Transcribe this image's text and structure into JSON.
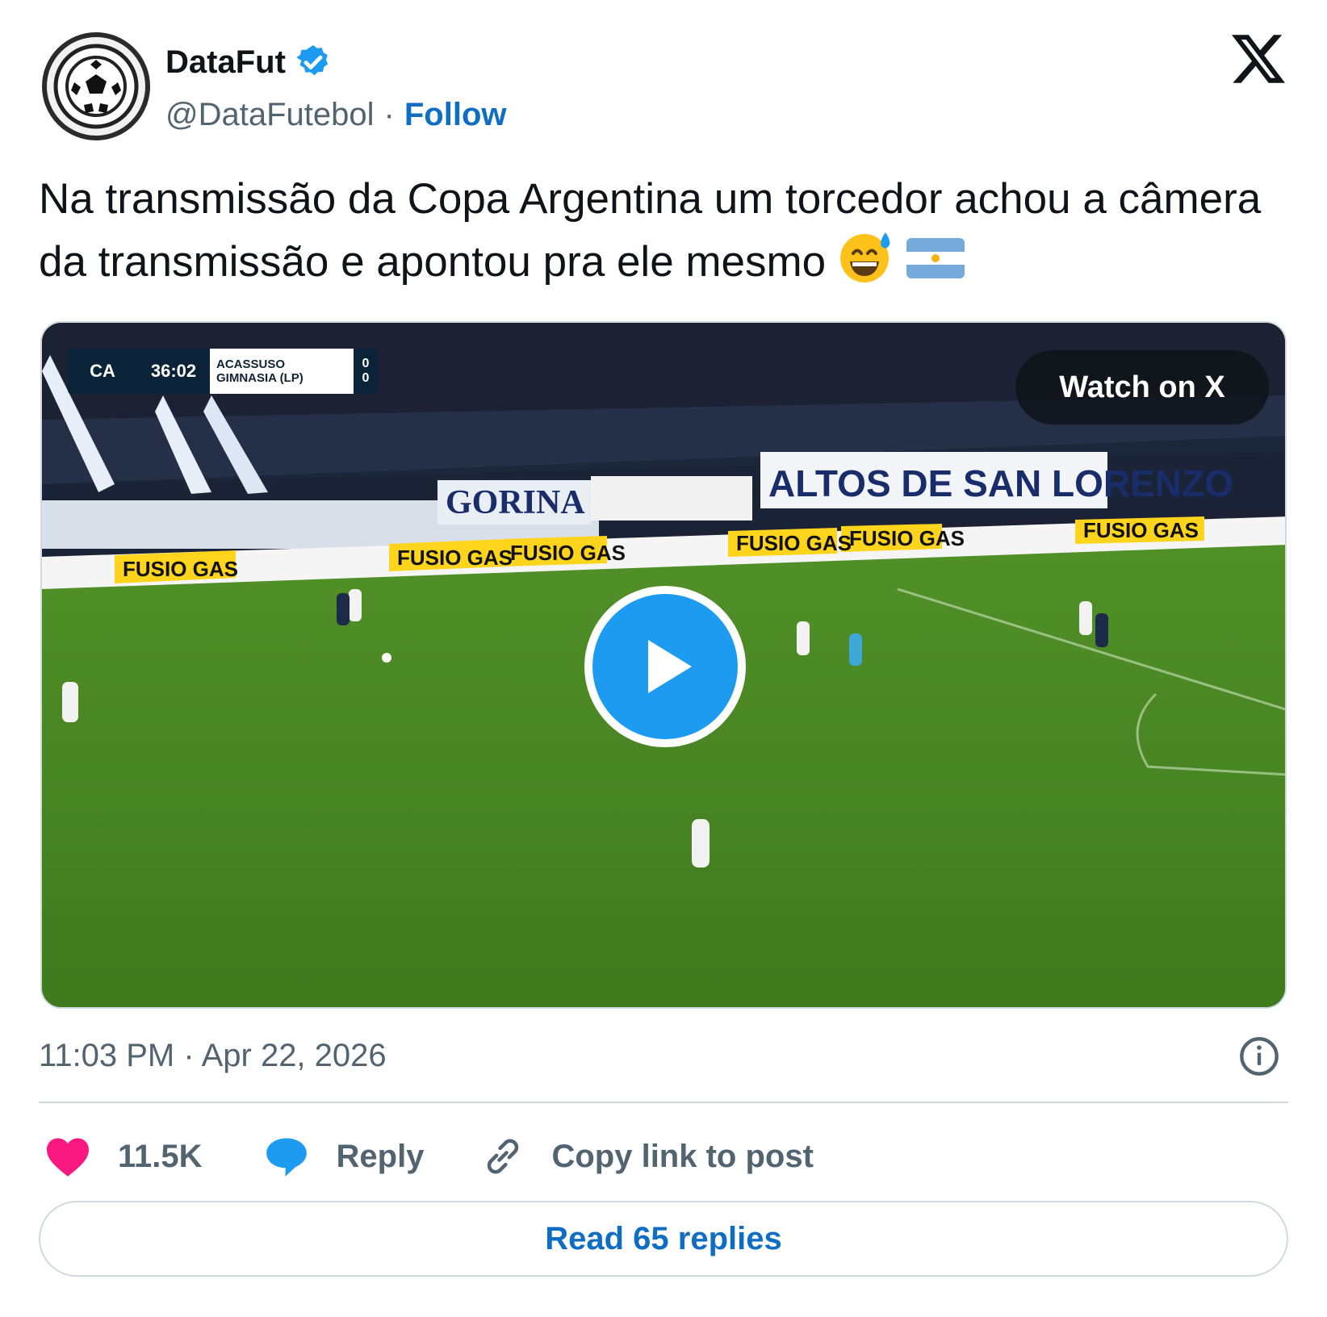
{
  "author": {
    "display_name": "DataFut",
    "handle": "@DataFutebol",
    "separator": "·",
    "follow_label": "Follow",
    "verified": true
  },
  "brand": {
    "icon": "x-logo-icon"
  },
  "tweet": {
    "text": "Na transmissão da Copa Argentina um torcedor achou a câmera da transmissão e apontou pra ele mesmo",
    "emojis": [
      "grinning-face-with-sweat",
      "argentina-flag"
    ]
  },
  "media": {
    "type": "video",
    "watch_label": "Watch on X",
    "scoreboard": {
      "logo": "CA",
      "clock": "36:02",
      "team_home": "ACASSUSO",
      "team_away": "GIMNASIA (LP)",
      "score_home": "0",
      "score_away": "0"
    },
    "banners": [
      "ALTOS DE SAN LORENZO",
      "GORINA",
      "FUSIO GAS"
    ]
  },
  "meta": {
    "timestamp": "11:03 PM · Apr 22, 2026"
  },
  "actions": {
    "like_count": "11.5K",
    "reply_label": "Reply",
    "copy_label": "Copy link to post"
  },
  "read_replies_label": "Read 65 replies",
  "colors": {
    "accent": "#1d9bf0",
    "link": "#0f6ec4",
    "like": "#f91880",
    "muted": "#536471",
    "border": "#cfd9de"
  }
}
